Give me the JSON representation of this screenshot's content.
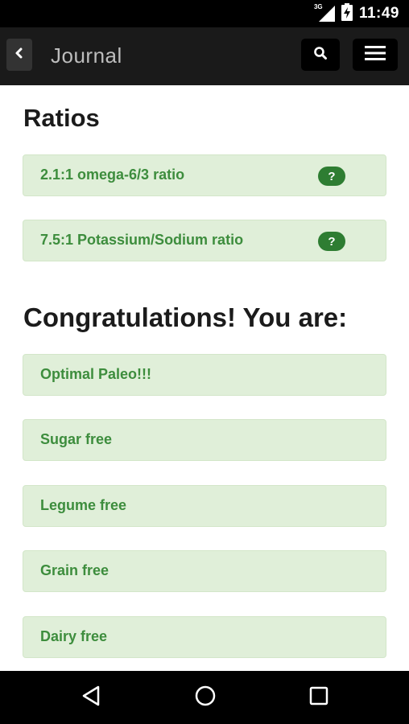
{
  "status_bar": {
    "network_label": "3G",
    "time": "11:49",
    "signal_icon": "signal-icon",
    "battery_icon": "battery-charging-icon"
  },
  "app_bar": {
    "title": "Journal",
    "back_icon": "chevron-left-icon",
    "search_icon": "search-icon",
    "menu_icon": "menu-icon"
  },
  "ratios": {
    "heading": "Ratios",
    "items": [
      {
        "label": "2.1:1 omega-6/3 ratio",
        "help": "?"
      },
      {
        "label": "7.5:1 Potassium/Sodium ratio",
        "help": "?"
      }
    ]
  },
  "congrats": {
    "heading": "Congratulations! You are:",
    "items": [
      {
        "label": "Optimal Paleo!!!"
      },
      {
        "label": "Sugar free"
      },
      {
        "label": "Legume free"
      },
      {
        "label": "Grain free"
      },
      {
        "label": "Dairy free"
      }
    ]
  },
  "nav_bar": {
    "back_icon": "nav-back-icon",
    "home_icon": "nav-home-icon",
    "recents_icon": "nav-recents-icon"
  },
  "colors": {
    "card_bg": "#e0efd9",
    "card_text": "#3d8d3d",
    "badge_bg": "#2e7d32",
    "app_bar_bg": "#1a1a1a"
  }
}
